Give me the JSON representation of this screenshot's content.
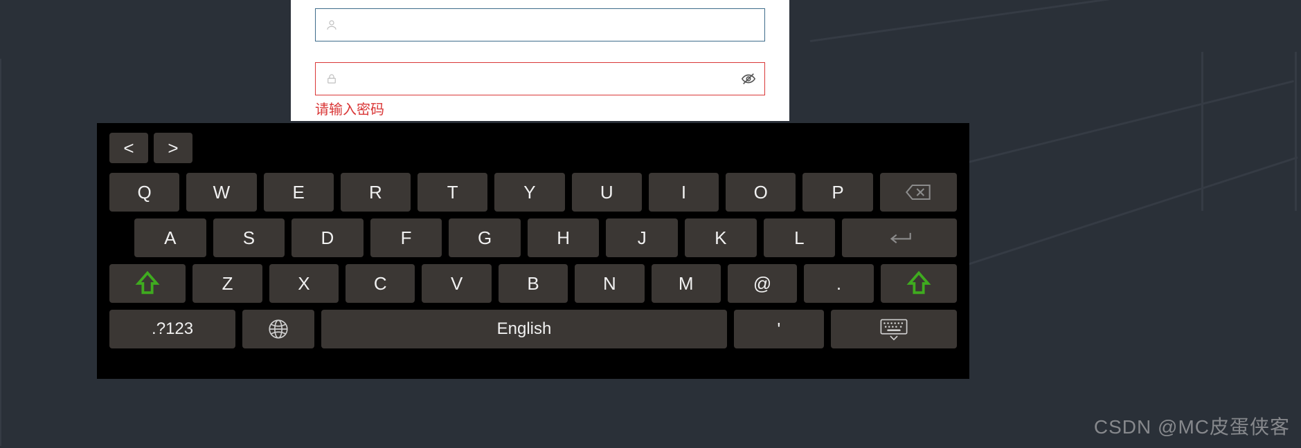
{
  "form": {
    "username": {
      "value": ""
    },
    "password": {
      "value": "",
      "error": "请输入密码"
    }
  },
  "keyboard": {
    "nav": {
      "prev": "<",
      "next": ">"
    },
    "rows": {
      "r1": [
        "Q",
        "W",
        "E",
        "R",
        "T",
        "Y",
        "U",
        "I",
        "O",
        "P"
      ],
      "r2": [
        "A",
        "S",
        "D",
        "F",
        "G",
        "H",
        "J",
        "K",
        "L"
      ],
      "r3": [
        "Z",
        "X",
        "C",
        "V",
        "B",
        "N",
        "M",
        "@",
        "."
      ]
    },
    "mode_label": ".?123",
    "space_label": "English",
    "apostrophe": "'"
  },
  "watermark": "CSDN @MC皮蛋侠客"
}
